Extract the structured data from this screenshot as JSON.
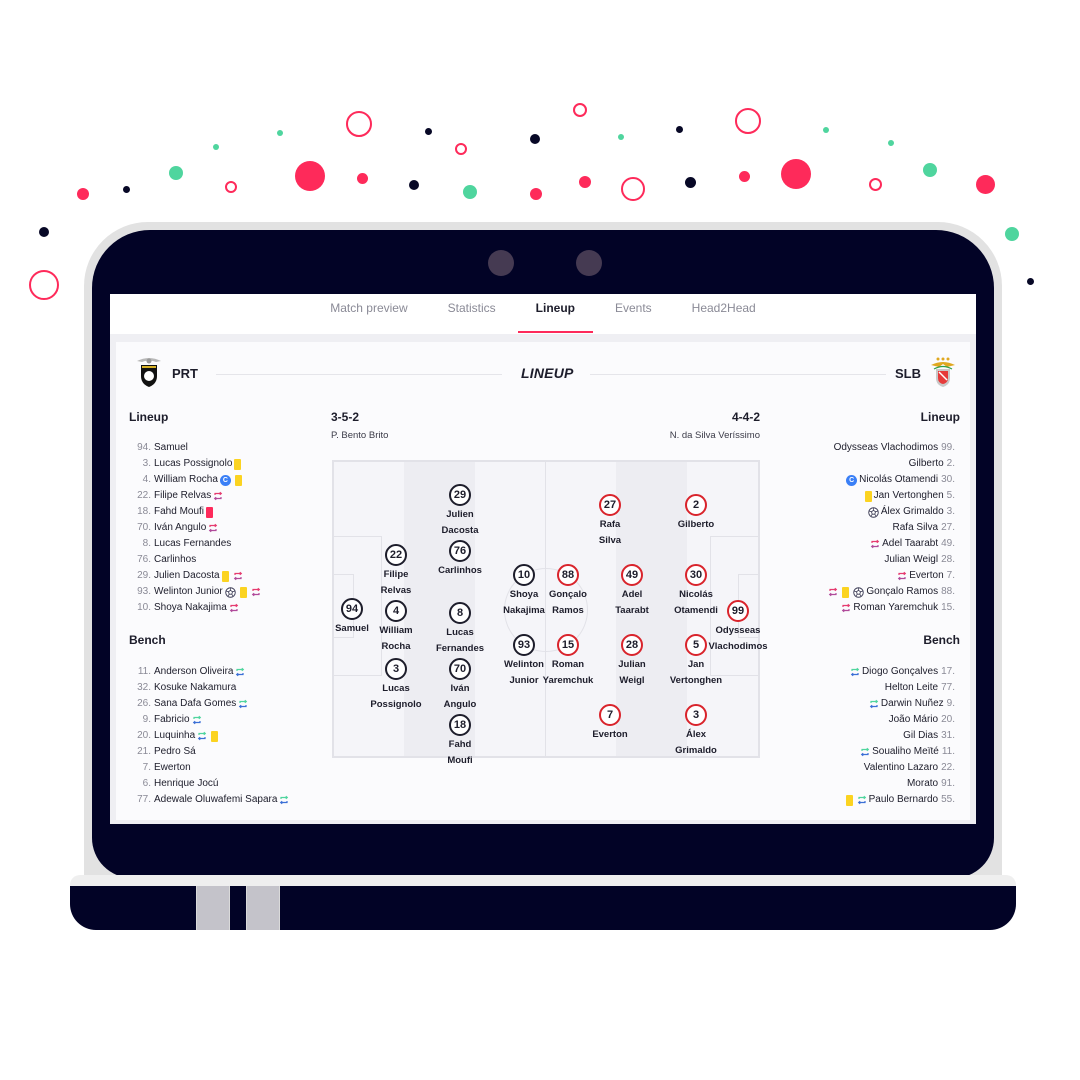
{
  "decor": {
    "colors": {
      "pink": "#fe2a5a",
      "navy": "#070826",
      "green": "#4fd59e"
    }
  },
  "tabs": [
    {
      "label": "Match preview",
      "active": false
    },
    {
      "label": "Statistics",
      "active": false
    },
    {
      "label": "Lineup",
      "active": true
    },
    {
      "label": "Events",
      "active": false
    },
    {
      "label": "Head2Head",
      "active": false
    }
  ],
  "header": {
    "title": "LINEUP",
    "home_team": {
      "code": "PRT",
      "crest": "portimonense-crest-icon"
    },
    "away_team": {
      "code": "SLB",
      "crest": "benfica-crest-icon"
    }
  },
  "home": {
    "lineup_title": "Lineup",
    "bench_title": "Bench",
    "formation": "3-5-2",
    "coach": "P. Bento Brito",
    "lineup": [
      {
        "num": "94.",
        "name": "Samuel",
        "icons": []
      },
      {
        "num": "3.",
        "name": "Lucas Possignolo",
        "icons": [
          "yellow-card"
        ]
      },
      {
        "num": "4.",
        "name": "William Rocha",
        "icons": [
          "captain",
          "yellow-card"
        ]
      },
      {
        "num": "22.",
        "name": "Filipe Relvas",
        "icons": [
          "sub-out"
        ]
      },
      {
        "num": "18.",
        "name": "Fahd Moufi",
        "icons": [
          "red-card"
        ]
      },
      {
        "num": "70.",
        "name": "Iván Angulo",
        "icons": [
          "sub-out"
        ]
      },
      {
        "num": "8.",
        "name": "Lucas Fernandes",
        "icons": []
      },
      {
        "num": "76.",
        "name": "Carlinhos",
        "icons": []
      },
      {
        "num": "29.",
        "name": "Julien Dacosta",
        "icons": [
          "yellow-card",
          "sub-out"
        ]
      },
      {
        "num": "93.",
        "name": "Welinton Junior",
        "icons": [
          "goal",
          "yellow-card",
          "sub-out"
        ]
      },
      {
        "num": "10.",
        "name": "Shoya Nakajima",
        "icons": [
          "sub-out"
        ]
      }
    ],
    "bench": [
      {
        "num": "11.",
        "name": "Anderson Oliveira",
        "icons": [
          "sub-in"
        ]
      },
      {
        "num": "32.",
        "name": "Kosuke Nakamura",
        "icons": []
      },
      {
        "num": "26.",
        "name": "Sana Dafa Gomes",
        "icons": [
          "sub-in"
        ]
      },
      {
        "num": "9.",
        "name": "Fabricio",
        "icons": [
          "sub-in"
        ]
      },
      {
        "num": "20.",
        "name": "Luquinha",
        "icons": [
          "sub-in",
          "yellow-card"
        ]
      },
      {
        "num": "21.",
        "name": "Pedro Sá",
        "icons": []
      },
      {
        "num": "7.",
        "name": "Ewerton",
        "icons": []
      },
      {
        "num": "6.",
        "name": "Henrique Jocú",
        "icons": []
      },
      {
        "num": "77.",
        "name": "Adewale Oluwafemi Sapara",
        "icons": [
          "sub-in"
        ]
      }
    ],
    "pitch": [
      {
        "num": "94",
        "first": "Samuel",
        "last": ""
      },
      {
        "num": "22",
        "first": "Filipe",
        "last": "Relvas"
      },
      {
        "num": "4",
        "first": "William",
        "last": "Rocha"
      },
      {
        "num": "3",
        "first": "Lucas",
        "last": "Possignolo"
      },
      {
        "num": "29",
        "first": "Julien",
        "last": "Dacosta"
      },
      {
        "num": "76",
        "first": "Carlinhos",
        "last": ""
      },
      {
        "num": "8",
        "first": "Lucas",
        "last": "Fernandes"
      },
      {
        "num": "70",
        "first": "Iván",
        "last": "Angulo"
      },
      {
        "num": "18",
        "first": "Fahd",
        "last": "Moufi"
      },
      {
        "num": "10",
        "first": "Shoya",
        "last": "Nakajima"
      },
      {
        "num": "93",
        "first": "Welinton",
        "last": "Junior"
      }
    ]
  },
  "away": {
    "lineup_title": "Lineup",
    "bench_title": "Bench",
    "formation": "4-4-2",
    "coach": "N. da Silva Veríssimo",
    "lineup": [
      {
        "num": "99.",
        "name": "Odysseas Vlachodimos",
        "icons": []
      },
      {
        "num": "2.",
        "name": "Gilberto",
        "icons": []
      },
      {
        "num": "30.",
        "name": "Nicolás Otamendi",
        "icons": [
          "captain"
        ]
      },
      {
        "num": "5.",
        "name": "Jan Vertonghen",
        "icons": [
          "yellow-card"
        ]
      },
      {
        "num": "3.",
        "name": "Álex Grimaldo",
        "icons": [
          "goal"
        ]
      },
      {
        "num": "27.",
        "name": "Rafa Silva",
        "icons": []
      },
      {
        "num": "49.",
        "name": "Adel Taarabt",
        "icons": [
          "sub-out"
        ]
      },
      {
        "num": "28.",
        "name": "Julian Weigl",
        "icons": []
      },
      {
        "num": "7.",
        "name": "Everton",
        "icons": [
          "sub-out"
        ]
      },
      {
        "num": "88.",
        "name": "Gonçalo Ramos",
        "icons": [
          "sub-out",
          "yellow-card",
          "goal"
        ]
      },
      {
        "num": "15.",
        "name": "Roman Yaremchuk",
        "icons": [
          "sub-out"
        ]
      }
    ],
    "bench": [
      {
        "num": "17.",
        "name": "Diogo Gonçalves",
        "icons": [
          "sub-in"
        ]
      },
      {
        "num": "77.",
        "name": "Helton Leite",
        "icons": []
      },
      {
        "num": "9.",
        "name": "Darwin Nuñez",
        "icons": [
          "sub-in"
        ]
      },
      {
        "num": "20.",
        "name": "João Mário",
        "icons": []
      },
      {
        "num": "31.",
        "name": "Gil Dias",
        "icons": []
      },
      {
        "num": "11.",
        "name": "Soualiho Meïté",
        "icons": [
          "sub-in"
        ]
      },
      {
        "num": "22.",
        "name": "Valentino Lazaro",
        "icons": []
      },
      {
        "num": "91.",
        "name": "Morato",
        "icons": []
      },
      {
        "num": "55.",
        "name": "Paulo Bernardo",
        "icons": [
          "yellow-card",
          "sub-in"
        ]
      }
    ],
    "pitch": [
      {
        "num": "99",
        "first": "Odysseas",
        "last": "Vlachodimos"
      },
      {
        "num": "2",
        "first": "Gilberto",
        "last": ""
      },
      {
        "num": "30",
        "first": "Nicolás",
        "last": "Otamendi"
      },
      {
        "num": "5",
        "first": "Jan",
        "last": "Vertonghen"
      },
      {
        "num": "3",
        "first": "Álex",
        "last": "Grimaldo"
      },
      {
        "num": "27",
        "first": "Rafa",
        "last": "Silva"
      },
      {
        "num": "49",
        "first": "Adel",
        "last": "Taarabt"
      },
      {
        "num": "28",
        "first": "Julian",
        "last": "Weigl"
      },
      {
        "num": "7",
        "first": "Everton",
        "last": ""
      },
      {
        "num": "88",
        "first": "Gonçalo",
        "last": "Ramos"
      },
      {
        "num": "15",
        "first": "Roman",
        "last": "Yaremchuk"
      }
    ]
  }
}
